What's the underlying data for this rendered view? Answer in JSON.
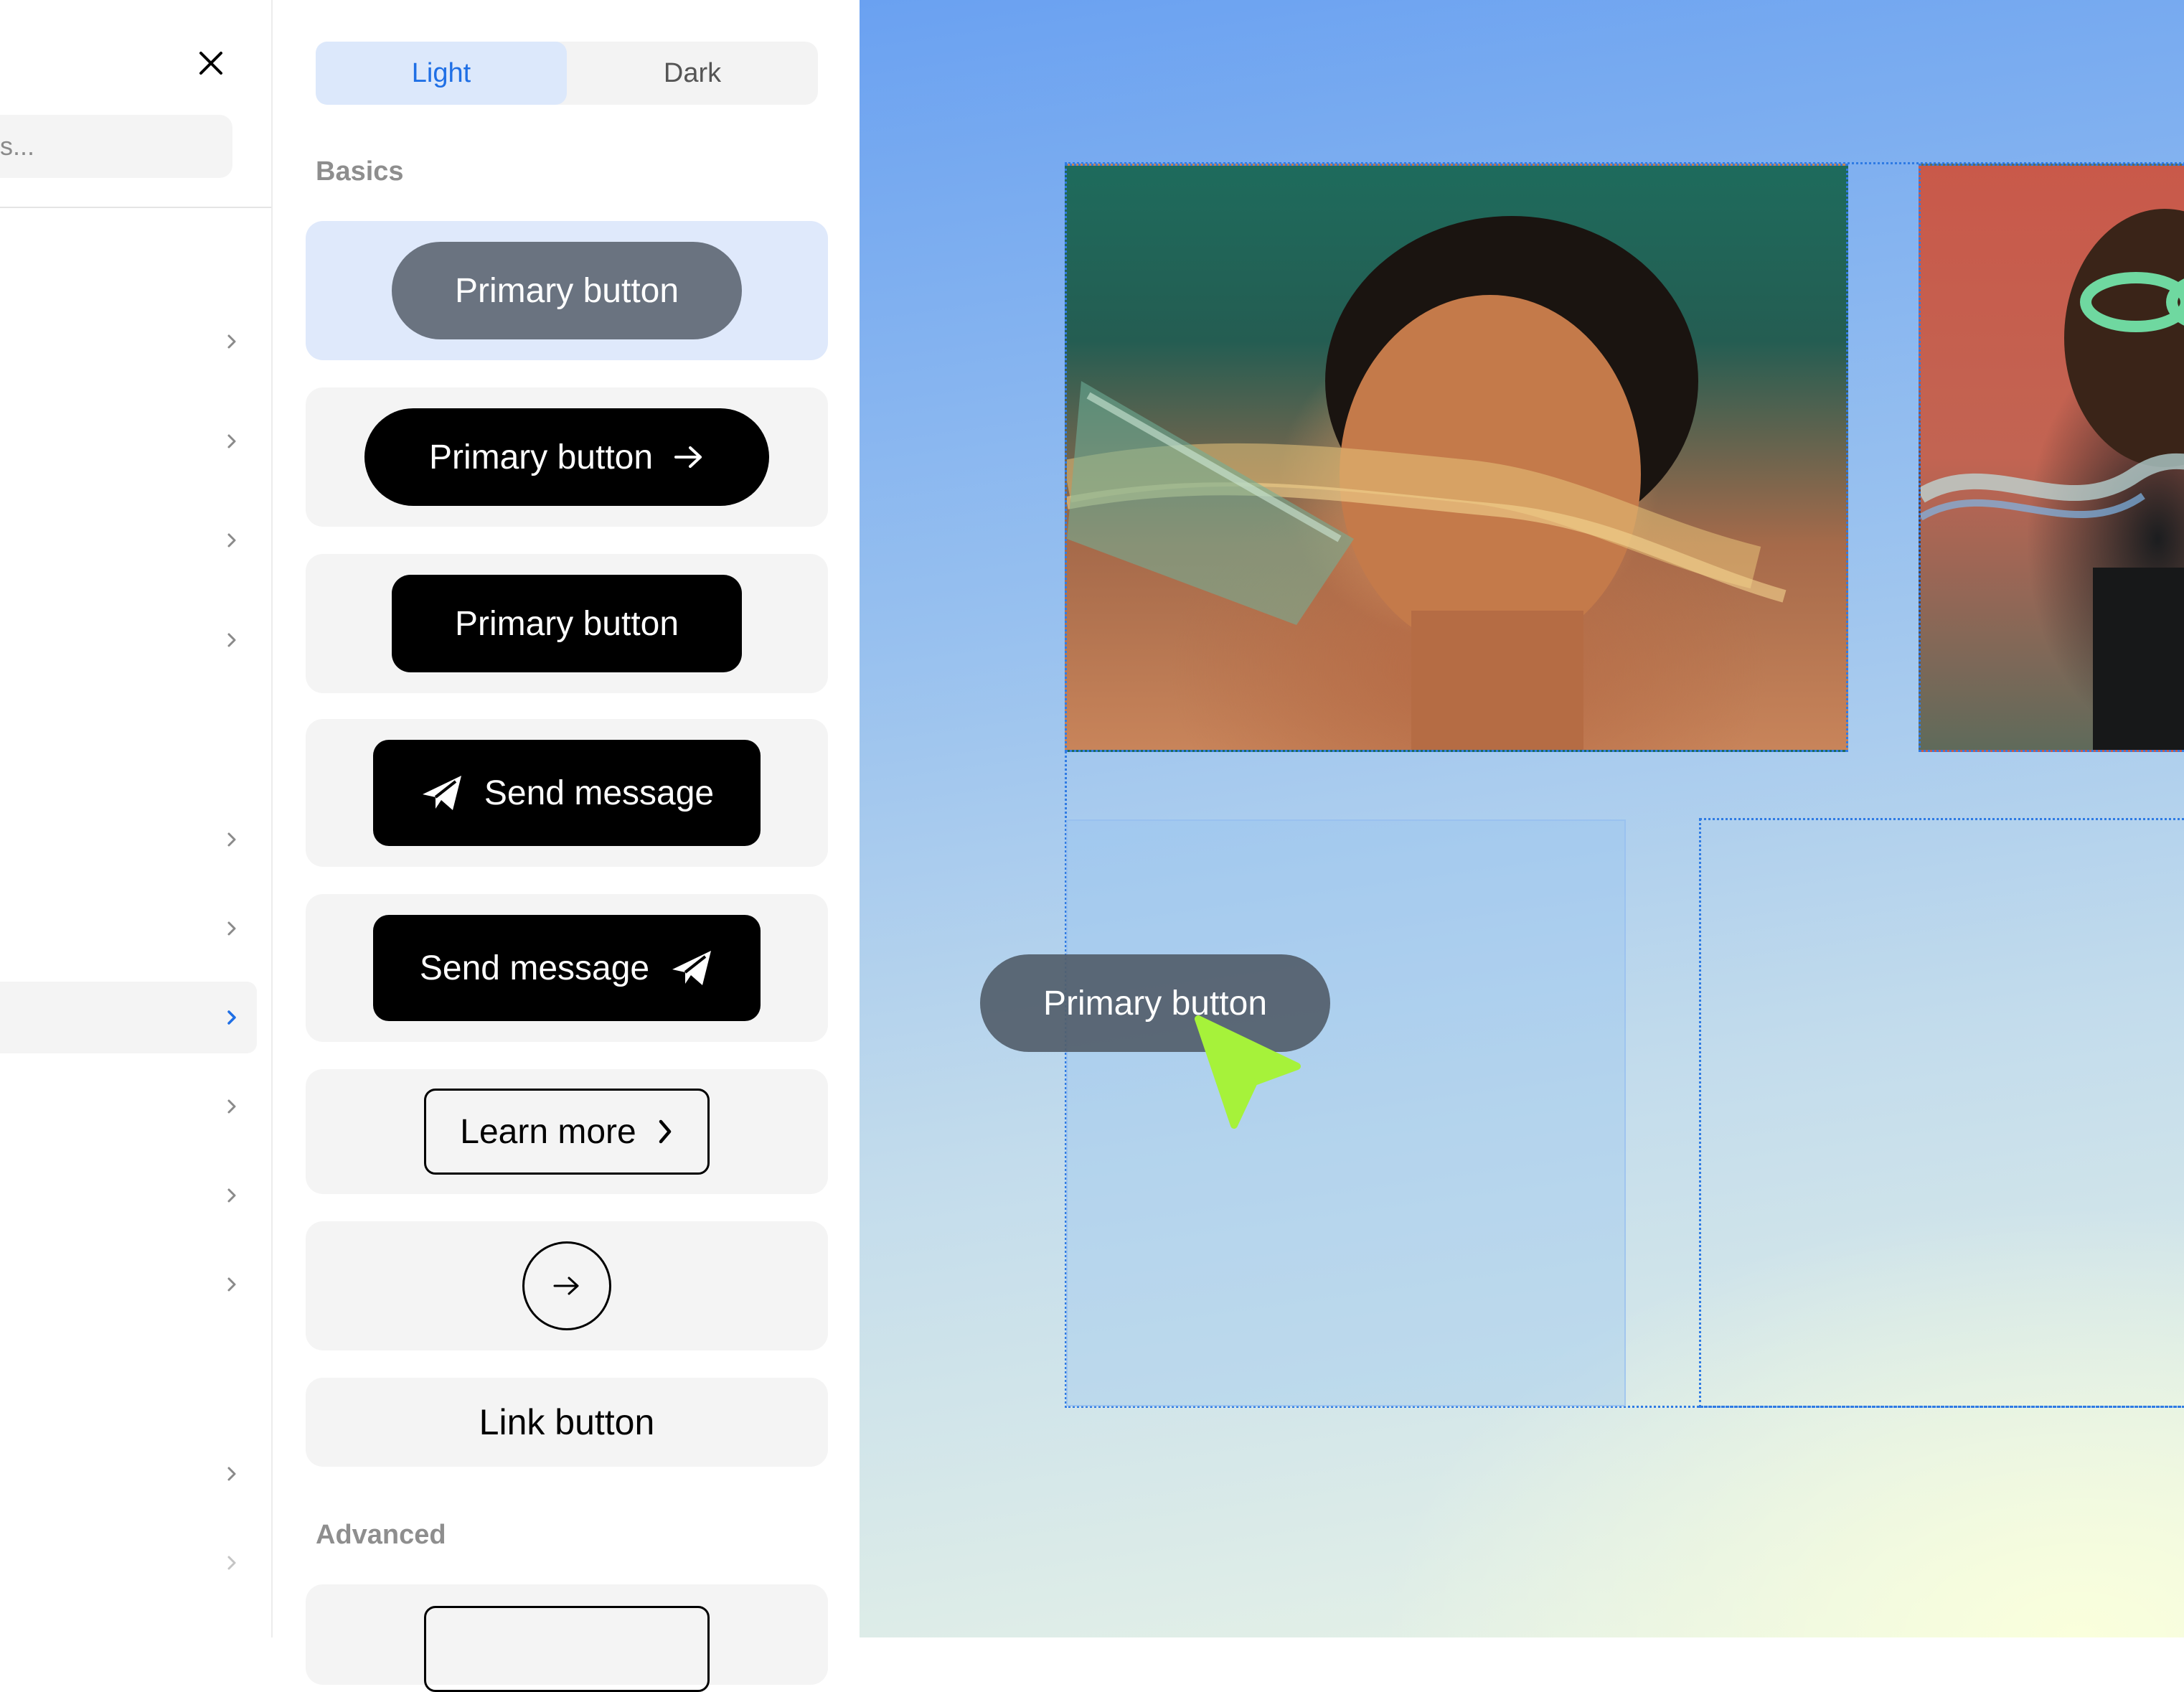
{
  "nav": {
    "search_placeholder": "us...",
    "items": [
      {
        "icon": "chevron-right-icon",
        "active": false
      },
      {
        "icon": "chevron-right-icon",
        "active": false
      },
      {
        "icon": "chevron-right-icon",
        "active": false
      },
      {
        "icon": "chevron-right-icon",
        "active": false
      },
      {
        "icon": "chevron-right-icon",
        "active": false
      },
      {
        "icon": "chevron-right-icon",
        "active": false
      },
      {
        "icon": "chevron-right-icon",
        "active": true
      },
      {
        "icon": "chevron-right-icon",
        "active": false
      },
      {
        "icon": "chevron-right-icon",
        "active": false
      },
      {
        "icon": "chevron-right-icon",
        "active": false
      },
      {
        "icon": "chevron-right-icon",
        "active": false
      },
      {
        "icon": "chevron-right-icon",
        "active": false
      }
    ]
  },
  "theme_toggle": {
    "light": "Light",
    "dark": "Dark",
    "selected": "Light"
  },
  "sections": {
    "basics": "Basics",
    "advanced": "Advanced"
  },
  "components": {
    "primary_gray": "Primary button",
    "primary_arrow": "Primary button",
    "primary_rect": "Primary button",
    "send_left": "Send message",
    "send_right": "Send message",
    "learn_more": "Learn more",
    "link_button": "Link button"
  },
  "canvas": {
    "floating_button": "Primary button"
  },
  "colors": {
    "accent": "#1f6fe5",
    "selected_card": "#dfe9fb",
    "cursor": "#a6f23a",
    "primary_gray": "#6a7380"
  }
}
